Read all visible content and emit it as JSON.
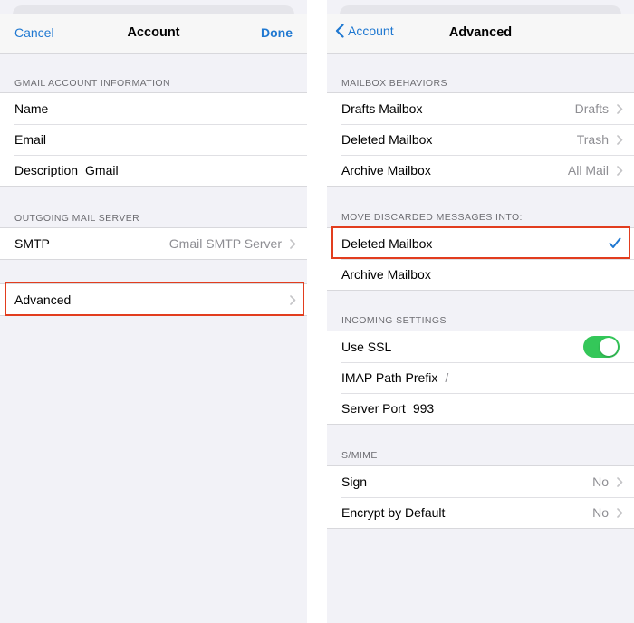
{
  "left": {
    "nav": {
      "cancel": "Cancel",
      "title": "Account",
      "done": "Done"
    },
    "gmail_section": {
      "header": "GMAIL ACCOUNT INFORMATION",
      "rows": [
        {
          "label": "Name",
          "value": ""
        },
        {
          "label": "Email",
          "value": ""
        },
        {
          "label": "Description",
          "value": "Gmail"
        }
      ]
    },
    "outgoing_section": {
      "header": "OUTGOING MAIL SERVER",
      "smtp_label": "SMTP",
      "smtp_value": "Gmail SMTP Server"
    },
    "advanced_label": "Advanced"
  },
  "right": {
    "nav": {
      "back": "Account",
      "title": "Advanced"
    },
    "mailbox_behaviors": {
      "header": "MAILBOX BEHAVIORS",
      "rows": [
        {
          "label": "Drafts Mailbox",
          "value": "Drafts"
        },
        {
          "label": "Deleted Mailbox",
          "value": "Trash"
        },
        {
          "label": "Archive Mailbox",
          "value": "All Mail"
        }
      ]
    },
    "move_discarded": {
      "header": "MOVE DISCARDED MESSAGES INTO:",
      "rows": [
        {
          "label": "Deleted Mailbox",
          "checked": true
        },
        {
          "label": "Archive Mailbox",
          "checked": false
        }
      ]
    },
    "incoming_settings": {
      "header": "INCOMING SETTINGS",
      "use_ssl_label": "Use SSL",
      "use_ssl_on": true,
      "imap_prefix_label": "IMAP Path Prefix",
      "imap_prefix_value": "/",
      "server_port_label": "Server Port",
      "server_port_value": "993"
    },
    "smime": {
      "header": "S/MIME",
      "rows": [
        {
          "label": "Sign",
          "value": "No"
        },
        {
          "label": "Encrypt by Default",
          "value": "No"
        }
      ]
    }
  },
  "colors": {
    "accent": "#1f78d1",
    "toggle_on": "#34c759",
    "highlight": "#e23d1e"
  }
}
